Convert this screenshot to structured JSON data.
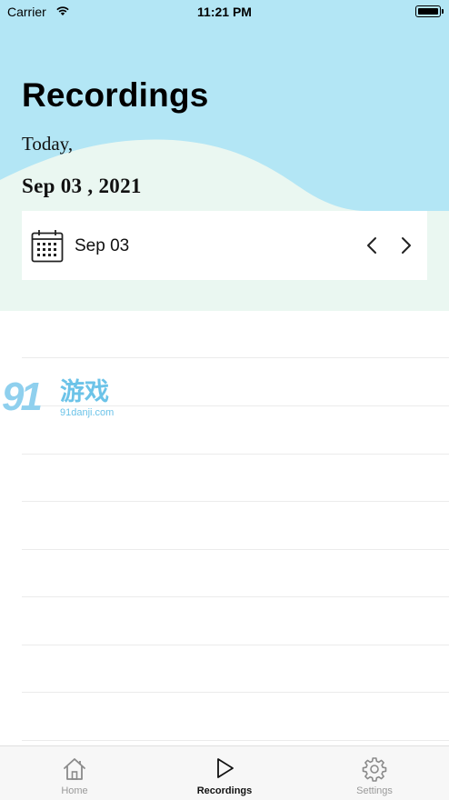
{
  "status_bar": {
    "carrier": "Carrier",
    "time": "11:21 PM",
    "wifi_icon": "wifi-icon",
    "battery_icon": "battery-icon"
  },
  "header": {
    "title": "Recordings",
    "greeting": "Today,",
    "full_date": "Sep 03 , 2021",
    "colors": {
      "wave_top": "#b3e6f5",
      "wave_bottom": "#eaf7f1"
    }
  },
  "date_picker": {
    "date": "Sep 03",
    "calendar_icon": "calendar-icon",
    "prev_icon": "chevron-left-icon",
    "next_icon": "chevron-right-icon"
  },
  "recordings_list": {
    "rows": [
      "",
      "",
      "",
      "",
      "",
      "",
      "",
      "",
      ""
    ]
  },
  "watermark": {
    "number": "91",
    "brand": "游戏",
    "url": "91danji.com"
  },
  "tab_bar": {
    "tabs": [
      {
        "label": "Home",
        "icon": "home-icon",
        "active": false
      },
      {
        "label": "Recordings",
        "icon": "play-icon",
        "active": true
      },
      {
        "label": "Settings",
        "icon": "gear-icon",
        "active": false
      }
    ]
  }
}
